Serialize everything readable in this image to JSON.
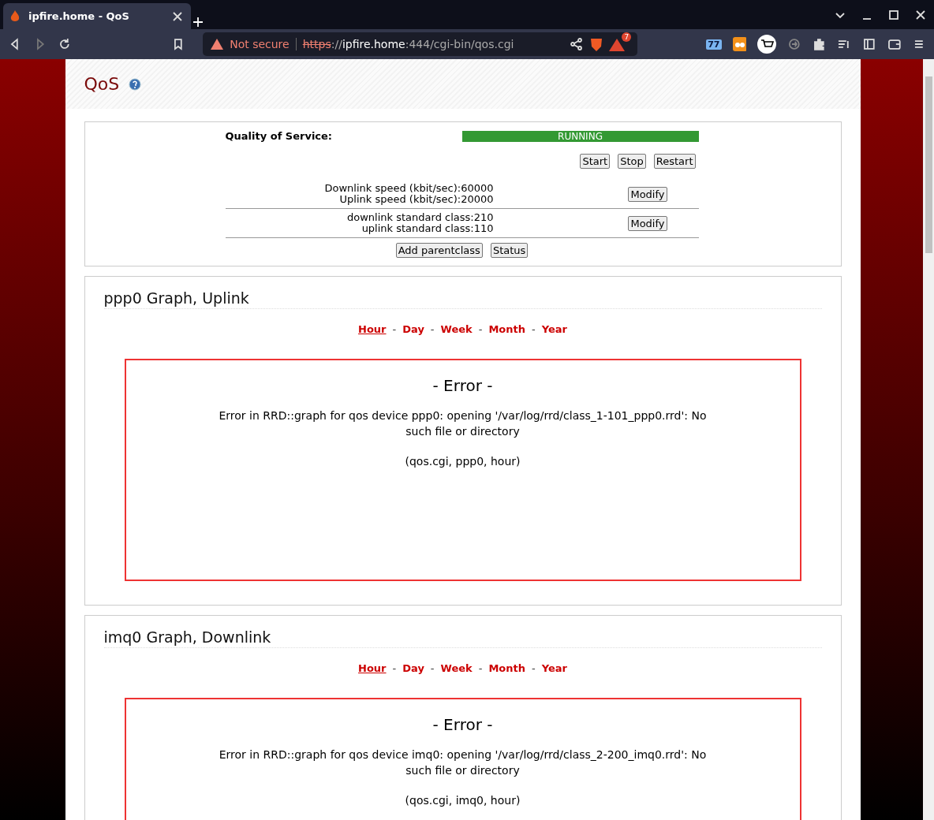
{
  "browser": {
    "tab": {
      "title": "ipfire.home - QoS"
    },
    "address": {
      "warning": "Not secure",
      "scheme": "https",
      "sep": "://",
      "host": "ipfire.home",
      "rest": ":444/cgi-bin/qos.cgi"
    },
    "rewards_badge": "7",
    "extension_badge": "77"
  },
  "page": {
    "title": "QoS",
    "status": {
      "label": "Quality of Service:",
      "state": "RUNNING",
      "running": true,
      "buttons": [
        "Start",
        "Stop",
        "Restart"
      ]
    },
    "settings": [
      {
        "lines": [
          "Downlink speed (kbit/sec):60000",
          "Uplink speed (kbit/sec):20000"
        ],
        "button": "Modify"
      },
      {
        "lines": [
          "downlink standard class:210",
          "uplink standard class:110"
        ],
        "button": "Modify"
      }
    ],
    "actions": [
      "Add parentclass",
      "Status"
    ],
    "graphs": [
      {
        "title": "ppp0 Graph, Uplink",
        "separator": "-",
        "periods": [
          {
            "label": "Hour",
            "selected": true
          },
          {
            "label": "Day",
            "selected": false
          },
          {
            "label": "Week",
            "selected": false
          },
          {
            "label": "Month",
            "selected": false
          },
          {
            "label": "Year",
            "selected": false
          }
        ],
        "error_title": "- Error -",
        "error": "Error in RRD::graph for qos device ppp0: opening '/var/log/rrd/class_1-101_ppp0.rrd': No such file or directory",
        "context": "(qos.cgi, ppp0, hour)"
      },
      {
        "title": "imq0 Graph, Downlink",
        "separator": "-",
        "periods": [
          {
            "label": "Hour",
            "selected": true
          },
          {
            "label": "Day",
            "selected": false
          },
          {
            "label": "Week",
            "selected": false
          },
          {
            "label": "Month",
            "selected": false
          },
          {
            "label": "Year",
            "selected": false
          }
        ],
        "error_title": "- Error -",
        "error": "Error in RRD::graph for qos device imq0: opening '/var/log/rrd/class_2-200_imq0.rrd': No such file or directory",
        "context": "(qos.cgi, imq0, hour)"
      }
    ]
  }
}
